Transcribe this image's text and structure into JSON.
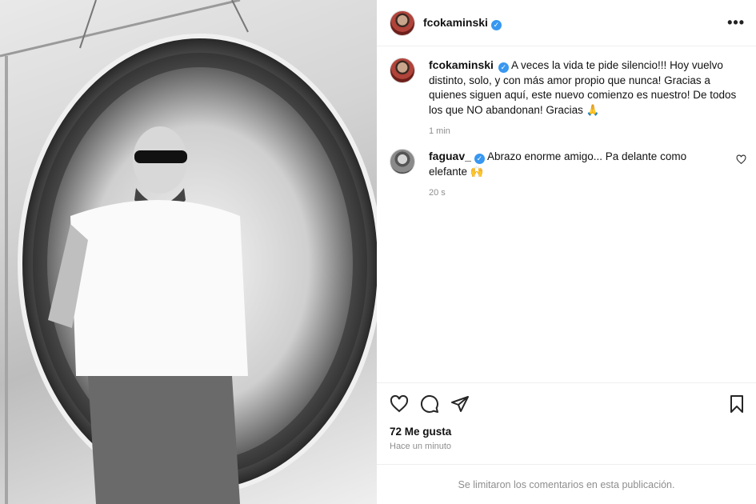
{
  "post": {
    "author": "fcokaminski",
    "more_icon": "more-horizontal-icon",
    "photo_icon": "post-photo"
  },
  "caption": {
    "username": "fcokaminski",
    "text": "A veces la vida te pide silencio!!! Hoy vuelvo distinto, solo, y con más amor propio que nunca! Gracias a quienes siguen aquí, este nuevo comienzo es nuestro! De todos los que NO abandonan! Gracias 🙏",
    "time": "1 min"
  },
  "comments": [
    {
      "username": "faguav_",
      "text": "Abrazo enorme amigo... Pa delante como elefante 🙌",
      "time": "20 s"
    }
  ],
  "actions": {
    "likes": "72 Me gusta",
    "posted": "Hace un minuto"
  },
  "footer": {
    "notice": "Se limitaron los comentarios en esta publicación."
  },
  "colors": {
    "verified": "#3897f0",
    "secondary_text": "#8e8e8e",
    "border": "#efefef"
  }
}
